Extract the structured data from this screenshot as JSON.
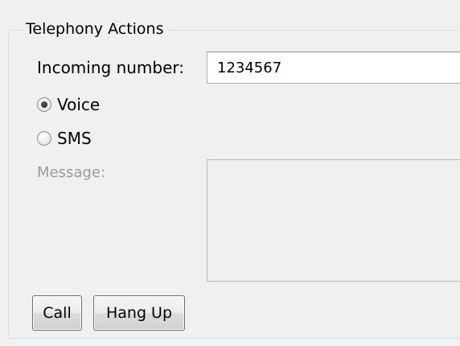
{
  "group": {
    "title": "Telephony Actions"
  },
  "incoming": {
    "label": "Incoming number:",
    "value": "1234567"
  },
  "mode": {
    "options": [
      {
        "label": "Voice",
        "selected": true
      },
      {
        "label": "SMS",
        "selected": false
      }
    ]
  },
  "message": {
    "label": "Message:",
    "value": "",
    "enabled": false
  },
  "buttons": {
    "call_label": "Call",
    "hangup_label": "Hang Up"
  }
}
